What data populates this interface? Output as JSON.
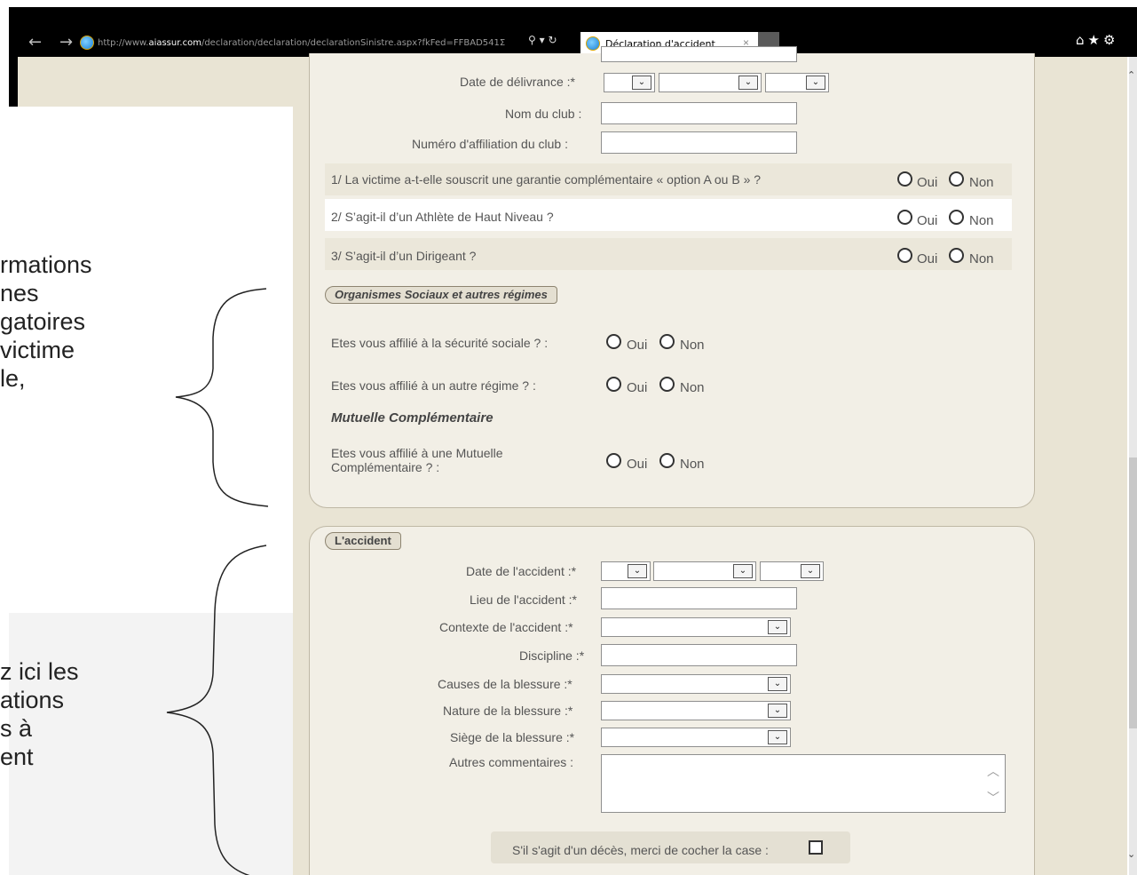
{
  "browser": {
    "url_prefix": "http://www.",
    "url_domain": "aiassur.com",
    "url_path": "/declaration/declaration/declarationSinistre.aspx?fkFed=FFBAD541Σ",
    "url_actions": "⚲ ▾ ↻",
    "tab_title": "Déclaration d'accident",
    "tab_close": "×",
    "back": "←",
    "forward": "→",
    "right_icons": "⌂★⚙"
  },
  "form": {
    "date_delivrance_label": "Date de délivrance :*",
    "nom_club_label": "Nom du club :",
    "numero_affiliation_label": "Numéro d'affiliation du club :",
    "questions": [
      {
        "text": "1/ La victime a-t-elle souscrit une garantie complémentaire « option A ou B » ?",
        "oui": "Oui",
        "non": "Non"
      },
      {
        "text": "2/ S’agit-il d’un Athlète de Haut Niveau ?",
        "oui": "Oui",
        "non": "Non"
      },
      {
        "text": "3/ S’agit-il d’un Dirigeant ?",
        "oui": "Oui",
        "non": "Non"
      }
    ],
    "organismes_legend": "Organismes Sociaux et autres régimes",
    "secu_label": "Etes vous affilié à la sécurité sociale ? :",
    "autre_regime_label": "Etes vous affilié à un autre régime ? :",
    "mutuelle_heading": "Mutuelle Complémentaire",
    "mutuelle_label_1": "Etes vous affilié à une Mutuelle",
    "mutuelle_label_2": "Complémentaire ? :",
    "oui": "Oui",
    "non": "Non",
    "accident_legend": "L'accident",
    "date_accident_label": "Date de l'accident :*",
    "lieu_label": "Lieu de l'accident :*",
    "contexte_label": "Contexte de l'accident :*",
    "discipline_label": "Discipline :*",
    "causes_label": "Causes de la blessure :*",
    "nature_label": "Nature de la blessure :*",
    "siege_label": "Siège de la blessure :*",
    "commentaires_label": "Autres commentaires :",
    "deces_label": "S'il s'agit d'un décès, merci de cocher la case :"
  },
  "annotations": {
    "upper": [
      "rmations",
      "nes",
      "gatoires",
      "victime",
      "le,"
    ],
    "lower": [
      "z ici les",
      "ations",
      "s à",
      "ent"
    ]
  },
  "glyphs": {
    "select_arrow": "⌄",
    "scroll_up": "⌃",
    "scroll_down": "⌄",
    "ta_up": "︿",
    "ta_down": "﹀"
  }
}
